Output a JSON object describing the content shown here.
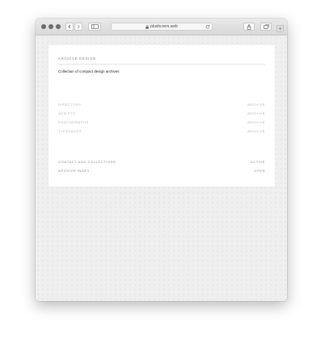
{
  "browser": {
    "url": "plushcrem.web",
    "icons": [
      "back-icon",
      "forward-icon",
      "sidebar-icon",
      "lock-icon",
      "reload-icon",
      "share-icon",
      "tabs-icon",
      "new-tab-icon"
    ]
  },
  "page": {
    "title": "ARCHIVE DESIGN",
    "subtitle": "Collection of compact design archives",
    "rows": [
      {
        "label": "DIRECTORY",
        "value": "ARCHIVE"
      },
      {
        "label": "SCRIPTS",
        "value": "ARCHIVE"
      },
      {
        "label": "PHOTOGRAPHS",
        "value": "ARCHIVE"
      },
      {
        "label": "TYPEFACES",
        "value": "ARCHIVE"
      }
    ],
    "footer_rows": [
      {
        "label": "CONTACT AND COLLECTIONS",
        "value": "ACTIVE"
      },
      {
        "label": "ARCHIVE INDEX",
        "value": "OPEN"
      }
    ]
  }
}
